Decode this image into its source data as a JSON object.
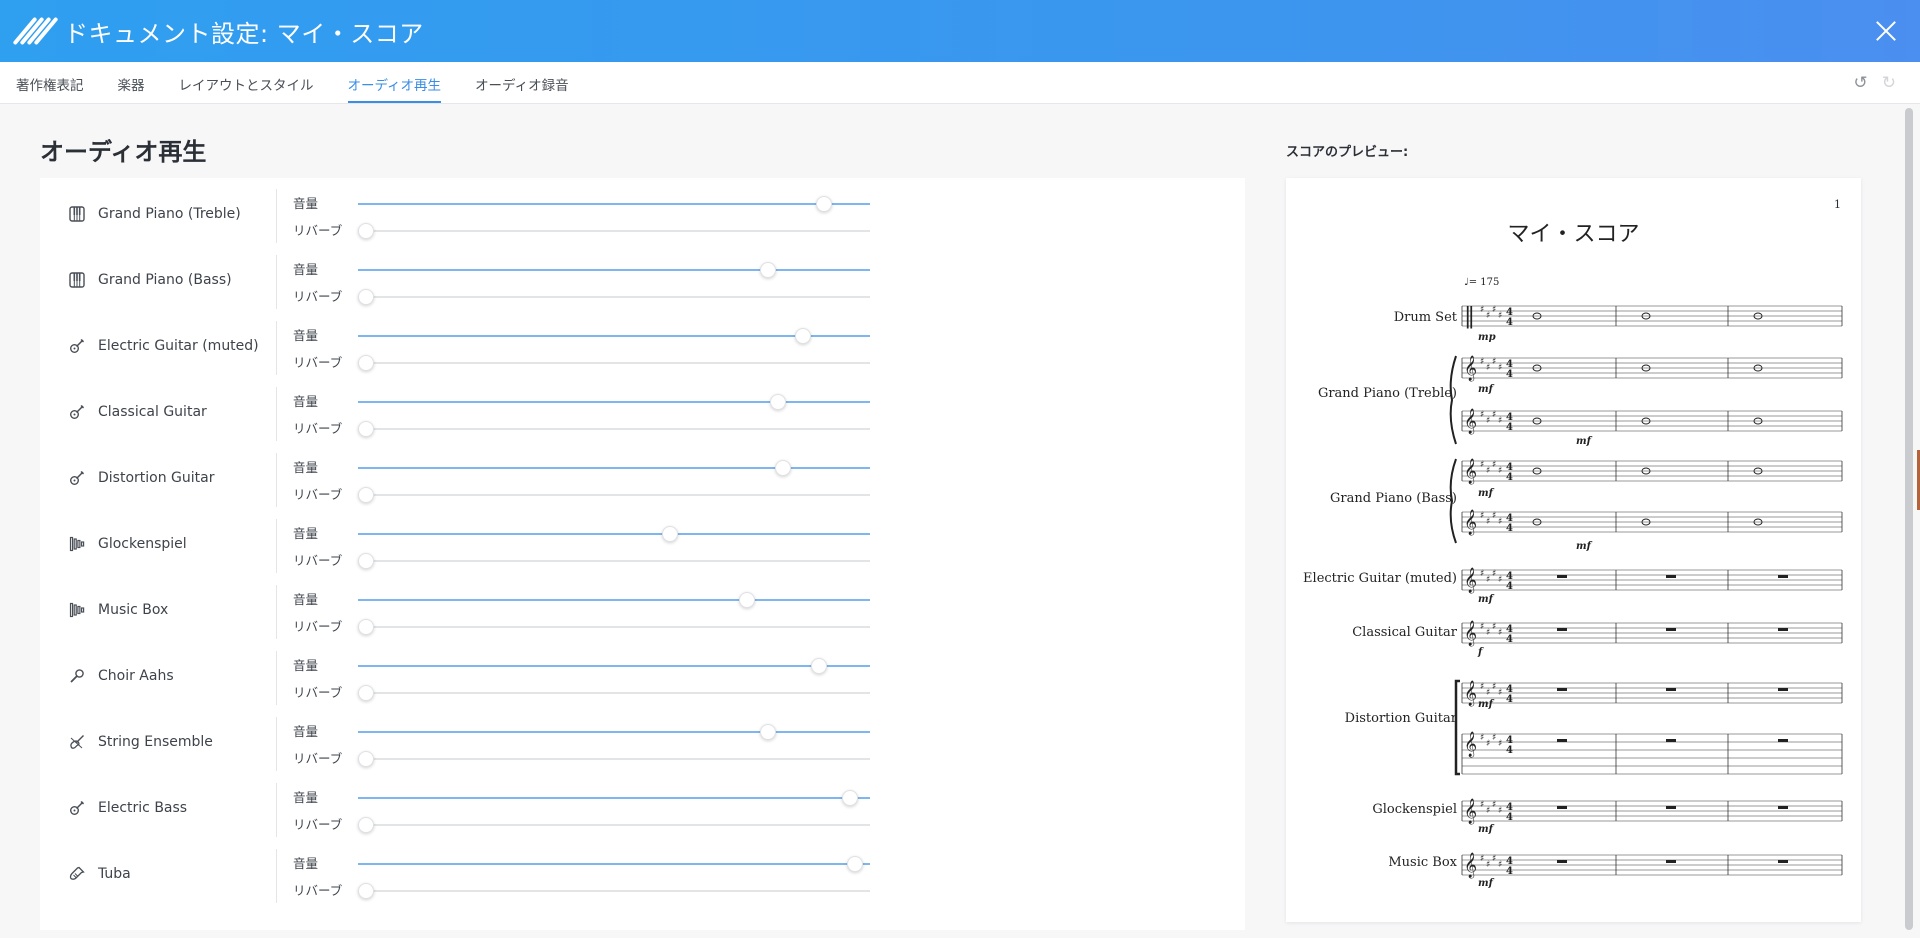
{
  "header": {
    "title": "ドキュメント設定: マイ・スコア"
  },
  "tabs": [
    {
      "label": "著作権表記",
      "active": false
    },
    {
      "label": "楽器",
      "active": false
    },
    {
      "label": "レイアウトとスタイル",
      "active": false
    },
    {
      "label": "オーディオ再生",
      "active": true
    },
    {
      "label": "オーディオ録音",
      "active": false
    }
  ],
  "section": {
    "title": "オーディオ再生"
  },
  "labels": {
    "volume": "音量",
    "reverb": "リバーブ"
  },
  "instruments": [
    {
      "name": "Grand Piano (Treble)",
      "icon": "piano-icon",
      "volume": 0.91,
      "reverb": 0.0
    },
    {
      "name": "Grand Piano (Bass)",
      "icon": "piano-icon",
      "volume": 0.8,
      "reverb": 0.0
    },
    {
      "name": "Electric Guitar (muted)",
      "icon": "guitar-icon",
      "volume": 0.87,
      "reverb": 0.0
    },
    {
      "name": "Classical Guitar",
      "icon": "guitar-icon",
      "volume": 0.82,
      "reverb": 0.0
    },
    {
      "name": "Distortion Guitar",
      "icon": "guitar-icon",
      "volume": 0.83,
      "reverb": 0.0
    },
    {
      "name": "Glockenspiel",
      "icon": "glockenspiel-icon",
      "volume": 0.61,
      "reverb": 0.0
    },
    {
      "name": "Music Box",
      "icon": "glockenspiel-icon",
      "volume": 0.76,
      "reverb": 0.0
    },
    {
      "name": "Choir Aahs",
      "icon": "microphone-icon",
      "volume": 0.9,
      "reverb": 0.0
    },
    {
      "name": "String Ensemble",
      "icon": "violin-icon",
      "volume": 0.8,
      "reverb": 0.0
    },
    {
      "name": "Electric Bass",
      "icon": "guitar-icon",
      "volume": 0.96,
      "reverb": 0.0
    },
    {
      "name": "Tuba",
      "icon": "tuba-icon",
      "volume": 0.97,
      "reverb": 0.0
    }
  ],
  "preview": {
    "label": "スコアのプレビュー:",
    "page_number": "1",
    "score_title": "マイ・スコア",
    "tempo": "♩= 175",
    "staves": [
      {
        "name": "Drum Set",
        "dynamic": "mp"
      },
      {
        "name": "Grand Piano (Treble)",
        "dynamic": "mf",
        "dynamic2": "mf"
      },
      {
        "name": "Grand Piano (Bass)",
        "dynamic": "mf",
        "dynamic2": "mf"
      },
      {
        "name": "Electric Guitar (muted)",
        "dynamic": "mf"
      },
      {
        "name": "Classical Guitar",
        "dynamic": "f"
      },
      {
        "name": "Distortion Guitar",
        "dynamic": "mf"
      },
      {
        "name": "Glockenspiel",
        "dynamic": "mf"
      },
      {
        "name": "Music Box",
        "dynamic": "mf"
      }
    ]
  },
  "colors": {
    "header_start": "#2f9ff0",
    "header_end": "#4b8ff0",
    "accent": "#3a8ee6",
    "track_active": "#7fb6f0"
  }
}
